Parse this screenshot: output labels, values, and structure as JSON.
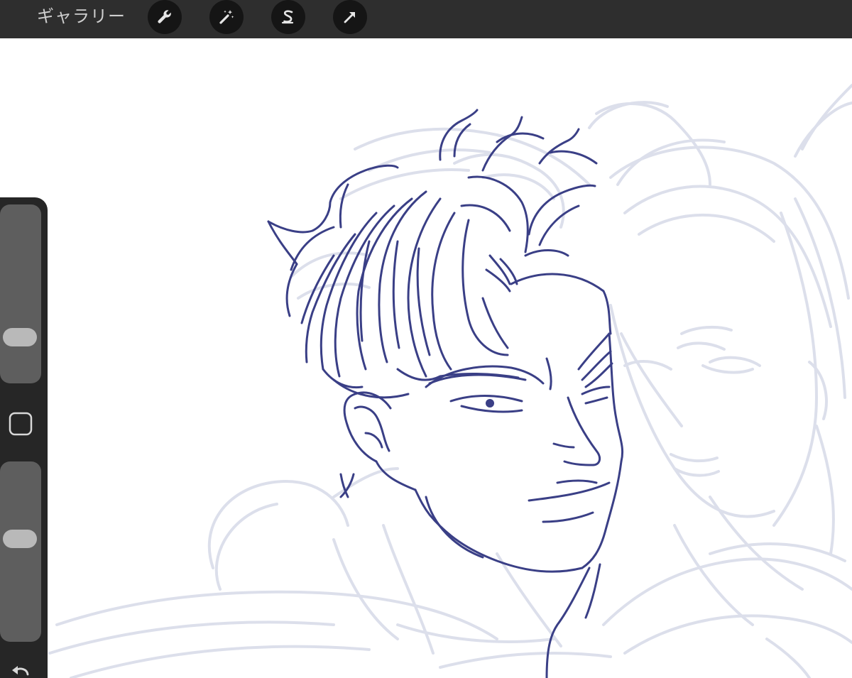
{
  "topbar": {
    "gallery_label": "ギャラリー",
    "tools": [
      {
        "name": "actions",
        "icon": "wrench-icon"
      },
      {
        "name": "adjustments",
        "icon": "magic-wand-icon"
      },
      {
        "name": "selection",
        "icon": "selection-s-icon"
      },
      {
        "name": "transform",
        "icon": "arrow-cursor-icon"
      }
    ],
    "background_color": "#2e2e2e",
    "button_color": "#151515",
    "icon_color": "#e6e6e6"
  },
  "sidebar": {
    "brush_size_level": 0.22,
    "brush_opacity_level": 0.58,
    "modify_icon": "square-icon",
    "undo_icon": "undo-icon",
    "background_color": "#262626",
    "track_color": "#5e5e5e",
    "thumb_color": "#b9b9b9"
  },
  "canvas": {
    "background_color": "#ffffff",
    "ink_color": "#3a3f86",
    "sketch_color": "#dcdfeb"
  }
}
